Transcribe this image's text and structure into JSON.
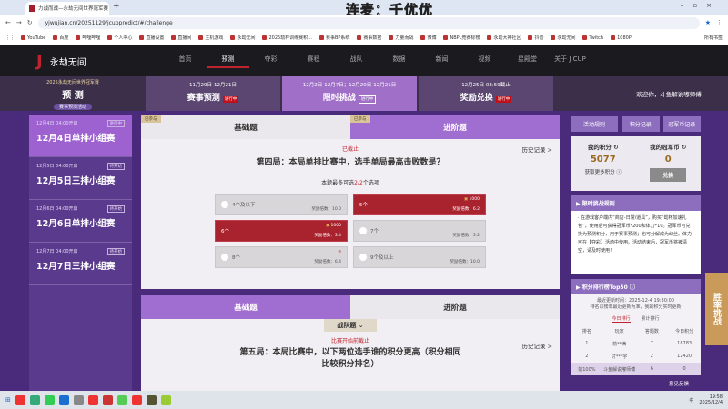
{
  "browser": {
    "tab_title": "力战而战—永劫无间世界冠军赛",
    "url": "yjwujian.cn/20251129/jcuppredict/#/challenge",
    "overlay": "连麦：千优优",
    "bookmarks": [
      "YouTube",
      "百度",
      "哔哩哔哩",
      "个人中心",
      "直播设置",
      "直播间",
      "主机游戏",
      "永劫无间",
      "2025劫杯训练赛积...",
      "赛事BP系统",
      "赛事数据",
      "力量而战",
      "微博",
      "NBPL竞赛标榜",
      "永劫大神社区",
      "抖音",
      "永劫无间",
      "Twitch",
      "1080P"
    ],
    "all_bookmarks": "所有书签"
  },
  "site": {
    "logo": "永劫无间",
    "nav": [
      "首页",
      "预测",
      "夺彩",
      "赛程",
      "战队",
      "数据",
      "新闻",
      "视频",
      "星殿堂",
      "关于 J CUP"
    ],
    "active_nav": 1
  },
  "banner": {
    "left_sub": "2025永劫无间世界冠军赛",
    "left_title": "预 测",
    "left_pill": "赛事预测活动",
    "items": [
      {
        "date": "11月29日-12月21日",
        "title": "赛事预测",
        "badge": "进行中"
      },
      {
        "date": "12月2日-12月7日；12月20日-12月21日",
        "title": "限时挑战",
        "badge": "进行中"
      },
      {
        "date": "12月25日 03:59截止",
        "title": "奖励兑换",
        "badge": "进行中"
      }
    ],
    "welcome": "欢迎你，斗鱼解说嘟师傅"
  },
  "sidebar": [
    {
      "date": "12月4日 04:00开启",
      "badge": "进行中",
      "name": "12月4日单排小组赛"
    },
    {
      "date": "12月5日 04:00开启",
      "badge": "待开始",
      "name": "12月5日三排小组赛"
    },
    {
      "date": "12月6日 04:00开启",
      "badge": "待开始",
      "name": "12月6日单排小组赛"
    },
    {
      "date": "12月7日 04:00开启",
      "badge": "待开始",
      "name": "12月7日三排小组赛"
    }
  ],
  "q1": {
    "tabs": [
      "基础题",
      "进阶题"
    ],
    "tag": "已参与",
    "status": "已截止",
    "title": "第四局：本局单排比赛中，选手单局最高击败数是？",
    "hint_pre": "本题最多可选",
    "hint_num": "2/2",
    "hint_post": "个选项",
    "history": "历史记录 >",
    "options": [
      {
        "label": "4个及以下",
        "mult": "奖励倍数：10.0"
      },
      {
        "label": "5个",
        "mult": "奖励倍数：6.2",
        "coin": "1000"
      },
      {
        "label": "6个",
        "mult": "奖励倍数：3.4",
        "coin": "1000"
      },
      {
        "label": "7个",
        "mult": "奖励倍数：3.2"
      },
      {
        "label": "8个",
        "mult": "奖励倍数：6.4"
      },
      {
        "label": "9个及以上",
        "mult": "奖励倍数：10.0"
      }
    ]
  },
  "q2": {
    "tabs": [
      "基础题",
      "进阶题"
    ],
    "dropdown": "战队题",
    "status": "比赛开始前截止",
    "title": "第五局：本局比赛中，以下两位选手谁的积分更高（积分相同比较积分排名）",
    "history": "历史记录 >"
  },
  "right": {
    "rules_btn": "活动规则",
    "points_log": "积分记录",
    "coins_log": "冠军币记录",
    "my_points_label": "我的积分",
    "my_points": "5077",
    "my_coins_label": "我的冠军币",
    "my_coins": "0",
    "more_points": "获取更多积分 ⓘ",
    "exchange": "兑换",
    "rules_title": "限时挑战规则",
    "rules_text": "· 在游戏客户端内“商店-日常/道具”，购买“劫杯加速礼包”，使用后可获得冠军币*200和体力*10。冠军币可兑换为预测积分，用于赛事预测；也可分解成为幻丝。体力可在【夺彩】活动中使用。活动结束后，冠军币将被清空，请及时使用！",
    "rank_title": "积分排行榜Top50 ⓘ",
    "rank_updated": "最近更新时间：2025-12-4 19:30:00",
    "rank_note": "排名以榜单最近更新为准，我的积分实时更新",
    "rank_tabs": [
      "今日排行",
      "累计排行"
    ],
    "rank_cols": [
      "排名",
      "玩家",
      "答题数",
      "今日积分"
    ],
    "rank_rows": [
      [
        "1",
        "箭**满",
        "7",
        "18783"
      ],
      [
        "2",
        "讨***宇",
        "2",
        "12420"
      ]
    ],
    "my_rank": [
      "前100%",
      "斗鱼解说嘟师傅",
      "6",
      "0"
    ]
  },
  "side_badge": "胜率挑战",
  "feedback": "意见反馈",
  "taskbar": {
    "time": "19:58",
    "date": "2025/12/4",
    "ime": "中"
  }
}
